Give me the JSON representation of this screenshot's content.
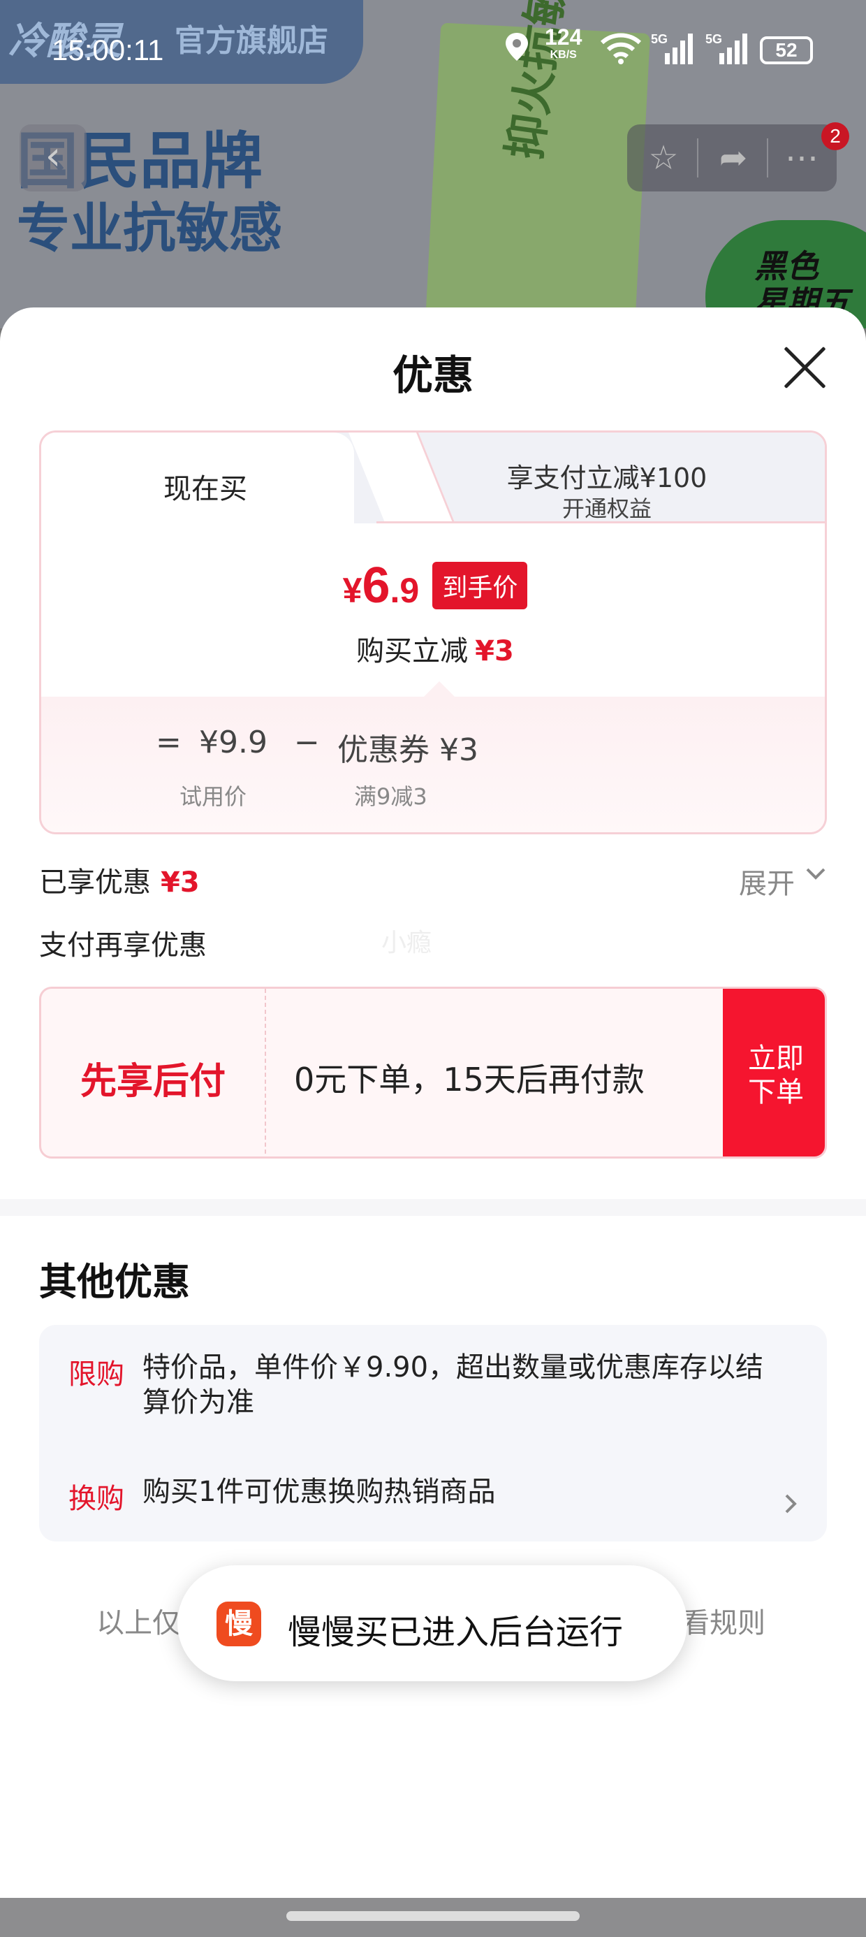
{
  "background": {
    "brand": "冷酸灵",
    "store": "官方旗舰店",
    "slogan_line1": "国民品牌",
    "slogan_line2": "专业抗敏感",
    "tube_label": "抑火抗敏",
    "badge_text": "黑色\n星期五"
  },
  "status_bar": {
    "time": "15:00:11",
    "net_speed": "124",
    "net_unit": "KB/S",
    "signal1": "5G",
    "signal2": "5G",
    "battery": "52"
  },
  "header": {
    "notification_count": "2"
  },
  "sheet": {
    "title": "优惠",
    "tabs": {
      "active_label": "现在买",
      "other_line1": "享支付立减¥100",
      "other_line2": "开通权益"
    },
    "price": {
      "currency": "¥",
      "integer": "6",
      "decimal": ".9",
      "tag": "到手价",
      "discount_label": "购买立减",
      "discount_value": "¥3"
    },
    "formula": {
      "equals": "=",
      "trial_price": "¥9.9",
      "minus": "−",
      "coupon": "优惠券 ¥3",
      "trial_price_label": "试用价",
      "coupon_label": "满9减3"
    },
    "enjoyed": {
      "label": "已享优惠",
      "value": "¥3",
      "expand": "展开"
    },
    "pay_more": "支付再享优惠",
    "watermark": "小瘾",
    "pay_later": {
      "title": "先享后付",
      "desc": "0元下单，15天后再付款",
      "button_line1": "立即",
      "button_line2": "下单"
    },
    "other": {
      "title": "其他优惠",
      "items": [
        {
          "tag": "限购",
          "text": "特价品，单件价￥9.90，超出数量或优惠库存以结算价为准"
        },
        {
          "tag": "换购",
          "text": "购买1件可优惠换购热销商品"
        }
      ]
    },
    "rules": {
      "left": "以上仅",
      "right": "看规则"
    }
  },
  "toast": {
    "icon_char": "慢",
    "message": "慢慢买已进入后台运行"
  },
  "colors": {
    "accent_red": "#e3152b",
    "button_red": "#f5152f",
    "card_border": "#f6d0d6"
  }
}
